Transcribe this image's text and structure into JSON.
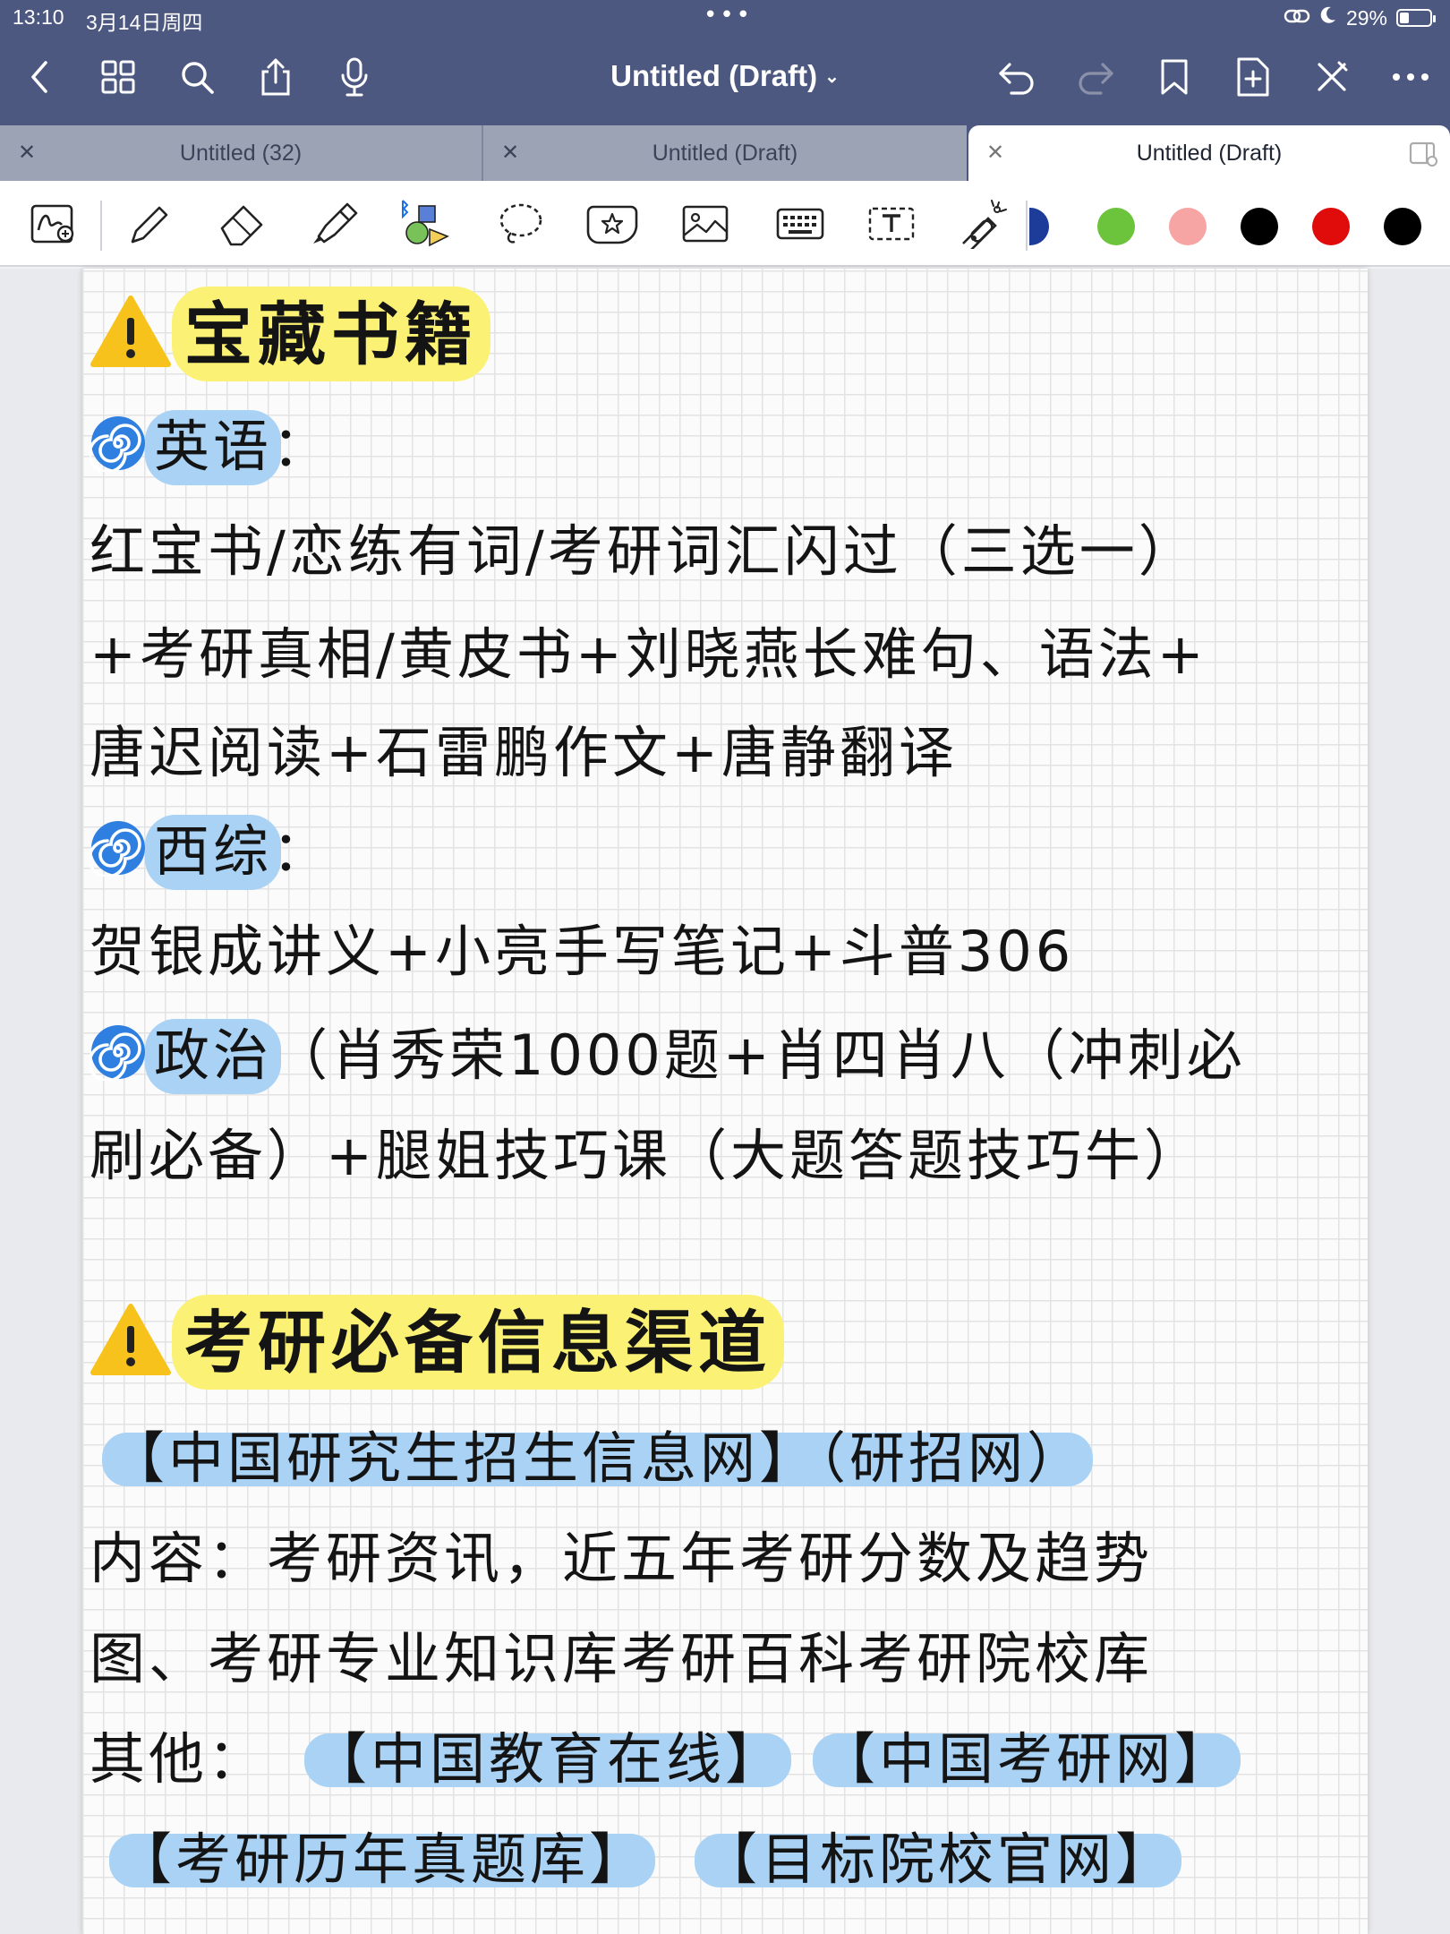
{
  "status": {
    "time": "13:10",
    "date": "3月14日周四",
    "battery": "29%"
  },
  "nav": {
    "title": "Untitled (Draft)",
    "icons": [
      "back-icon",
      "grid-icon",
      "search-icon",
      "share-icon",
      "mic-icon",
      "undo-icon",
      "redo-icon",
      "bookmark-icon",
      "add-page-icon",
      "close-pen-icon",
      "more-icon"
    ]
  },
  "tabs": [
    {
      "label": "Untitled (32)",
      "active": false
    },
    {
      "label": "Untitled (Draft)",
      "active": false
    },
    {
      "label": "Untitled (Draft)",
      "active": true
    }
  ],
  "toolbar": {
    "tools": [
      "handwriting-zoom",
      "pen",
      "eraser",
      "highlighter",
      "shapes",
      "lasso",
      "sticker",
      "image",
      "keyboard",
      "text-box",
      "laser-pointer"
    ],
    "colors": [
      "#2b53c9",
      "#6cc43c",
      "#f7a4a4",
      "#000000",
      "#e00b0b",
      "#000000"
    ]
  },
  "note": {
    "heading1": "宝藏书籍",
    "english_label": "英语",
    "english_colon": "：",
    "english_line1": "红宝书/恋练有词/考研词汇闪过（三选一）",
    "english_line2": "+考研真相/黄皮书+刘晓燕长难句、语法+",
    "english_line3": "唐迟阅读+石雷鹏作文+唐静翻译",
    "xizong_label": "西综",
    "xizong_colon": "：",
    "xizong_line1": "贺银成讲义+小亮手写笔记+斗普306",
    "politics_label": "政治",
    "politics_line1": "（肖秀荣1000题+肖四肖八（冲刺必",
    "politics_line2": "刷必备）+腿姐技巧课（大题答题技巧牛）",
    "heading2": "考研必备信息渠道",
    "site_main": "【中国研究生招生信息网】（研招网）",
    "content_prefix": "内容：",
    "content_line1": "考研资讯，近五年考研分数及趋势",
    "content_line2": "图、考研专业知识库考研百科考研院校库",
    "others_prefix": "其他：",
    "site_edu": "【中国教育在线】",
    "site_kaoyan": "【中国考研网】",
    "site_bank": "【考研历年真题库】",
    "site_school": "【目标院校官网】"
  }
}
